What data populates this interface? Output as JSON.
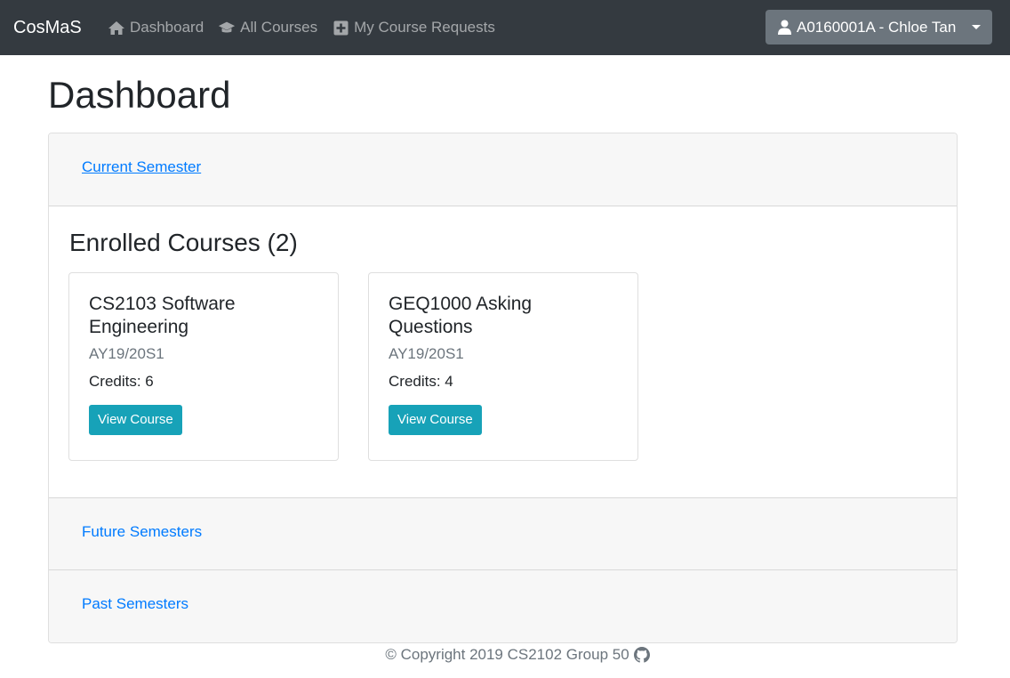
{
  "navbar": {
    "brand": "CosMaS",
    "items": [
      {
        "label": "Dashboard",
        "icon": "home-icon"
      },
      {
        "label": "All Courses",
        "icon": "graduation-cap-icon"
      },
      {
        "label": "My Course Requests",
        "icon": "plus-square-icon"
      }
    ],
    "user": {
      "label": "A0160001A - Chloe Tan",
      "icon": "user-icon"
    }
  },
  "page": {
    "title": "Dashboard"
  },
  "accordion": {
    "current": {
      "label": "Current Semester"
    },
    "enrolled_title": "Enrolled Courses (2)",
    "courses": [
      {
        "title": "CS2103 Software Engineering",
        "term": "AY19/20S1",
        "credits": "Credits: 6",
        "button": "View Course"
      },
      {
        "title": "GEQ1000 Asking Questions",
        "term": "AY19/20S1",
        "credits": "Credits: 4",
        "button": "View Course"
      }
    ],
    "future": {
      "label": "Future Semesters"
    },
    "past": {
      "label": "Past Semesters"
    }
  },
  "footer": {
    "text": "© Copyright 2019 CS2102 Group 50",
    "icon": "github-icon"
  },
  "colors": {
    "navbar": "#343a40",
    "link": "#007bff",
    "button": "#17a2b8",
    "user_button": "#6c757d"
  }
}
